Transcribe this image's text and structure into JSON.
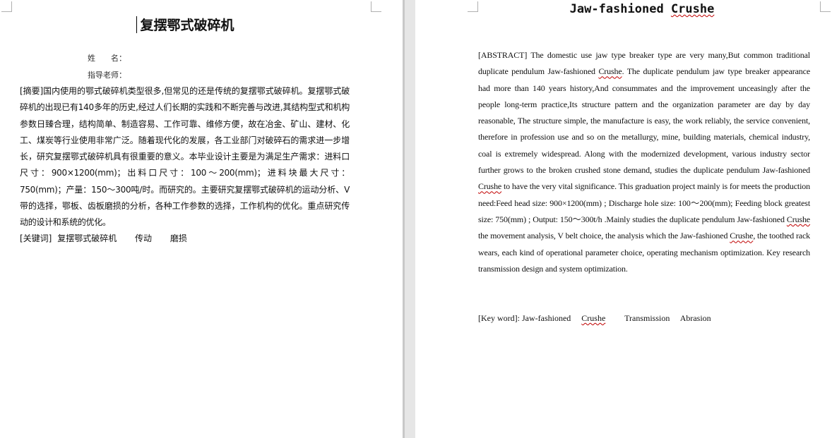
{
  "left_page": {
    "title": "复摆鄂式破碎机",
    "name_label": "姓　　名：",
    "advisor_label": "指导老师：",
    "abstract": "[摘要]国内使用的鄂式破碎机类型很多,但常见的还是传统的复摆鄂式破碎机。复摆鄂式破碎机的出现已有140多年的历史,经过人们长期的实践和不断完善与改进,其结构型式和机构参数日臻合理，结构简单、制造容易、工作可靠、维修方便，故在冶金、矿山、建材、化工、煤炭等行业使用非常广泛。随着现代化的发展，各工业部门对破碎石的需求进一步增长，研究复摆鄂式破碎机具有很重要的意义。本毕业设计主要是为满足生产需求：进料口尺寸：900×1200(mm)；出料口尺寸：100～200(mm)；进料块最大尺寸：750(mm)；产量：150～300吨/时。而研究的。主要研究复摆鄂式破碎机的运动分析、V带的选择，鄂板、齿板磨损的分析，各种工作参数的选择，工作机构的优化。重点研究传动的设计和系统的优化。",
    "keywords_label": "[关键词]",
    "keywords": [
      "复摆鄂式破碎机",
      "传动",
      "磨损"
    ]
  },
  "right_page": {
    "title_prefix": "Jaw-fashioned ",
    "title_suffix": "Crushe",
    "abstract_parts": [
      "[ABSTRACT] The domestic use jaw type breaker type are very many,But common traditional duplicate pendulum Jaw-fashioned ",
      "Crushe",
      ". The duplicate pendulum jaw type breaker appearance had more than 140 years history,And consummates and the improvement unceasingly after the people long-term practice,Its structure pattern and the organization parameter are day by day reasonable, The structure simple, the manufacture is easy, the work reliably, the service convenient, therefore in profession use and so on the metallurgy, mine, building materials, chemical industry, coal is extremely widespread. Along with the modernized development, various industry sector further grows to the broken crushed stone demand, studies the duplicate pendulum Jaw-fashioned ",
      "Crushe",
      " to have the very vital significance. This graduation project mainly is for meets the production need:Feed head size: 900×1200(mm) ; Discharge hole size: 100～200(mm); Feeding block greatest size: 750(mm) ; Output: 150～300t/h .Mainly studies the duplicate pendulum Jaw-fashioned ",
      "Crushe",
      " the movement analysis, V belt choice, the analysis which the Jaw-fashioned ",
      "Crushe",
      ", the toothed rack wears, each kind of operational parameter choice, operating mechanism optimization. Key research transmission design and system optimization."
    ],
    "keywords_label": "[Key word]: ",
    "keyword_1_prefix": "Jaw-fashioned ",
    "keyword_1_suffix": "Crushe",
    "keywords_rest": [
      "Transmission",
      "Abrasion"
    ]
  },
  "colors": {
    "gutter": "#e6e6e6",
    "spellcheck": "#c00000"
  }
}
